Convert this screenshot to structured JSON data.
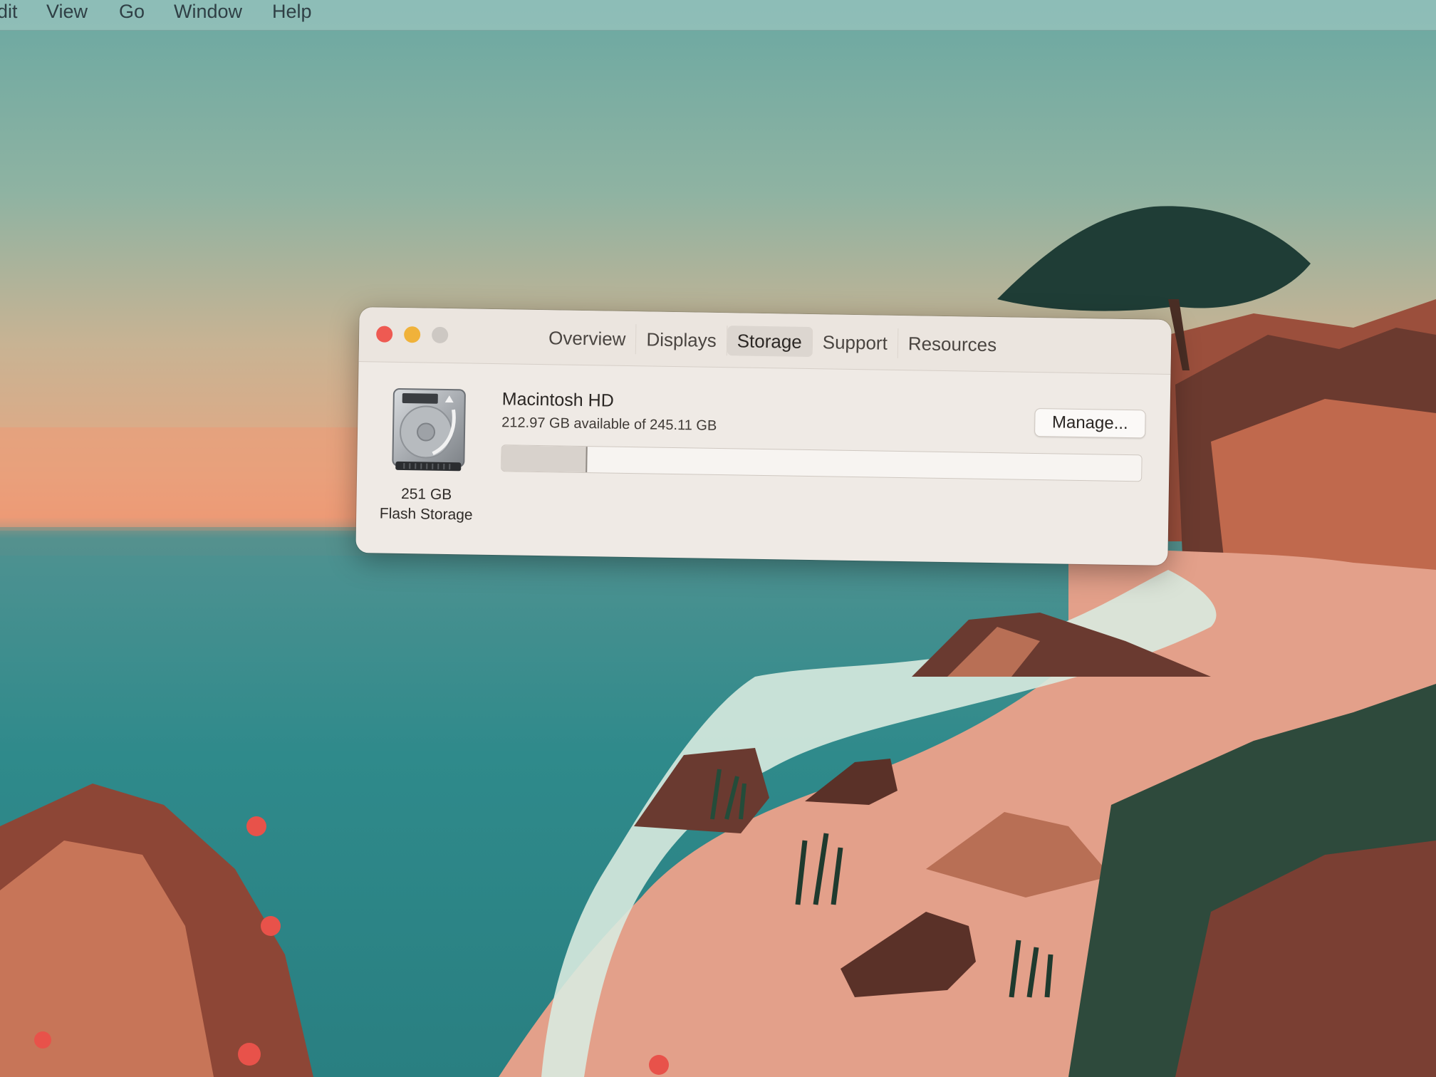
{
  "menubar": {
    "items": [
      {
        "label": "dit"
      },
      {
        "label": "View"
      },
      {
        "label": "Go"
      },
      {
        "label": "Window"
      },
      {
        "label": "Help"
      }
    ]
  },
  "window": {
    "tabs": [
      {
        "label": "Overview",
        "selected": false
      },
      {
        "label": "Displays",
        "selected": false
      },
      {
        "label": "Storage",
        "selected": true
      },
      {
        "label": "Support",
        "selected": false
      },
      {
        "label": "Resources",
        "selected": false
      }
    ],
    "disk": {
      "icon": "hard-drive-icon",
      "capacity_label": "251 GB",
      "type_label": "Flash Storage"
    },
    "volume": {
      "name": "Macintosh HD",
      "availability": "212.97 GB available of 245.11 GB",
      "used_fraction": 0.131
    },
    "manage_label": "Manage..."
  },
  "colors": {
    "close": "#ee5a52",
    "minimize": "#f0b23a",
    "zoom_inactive": "#cdc8c3",
    "window_bg": "#efeae5"
  }
}
